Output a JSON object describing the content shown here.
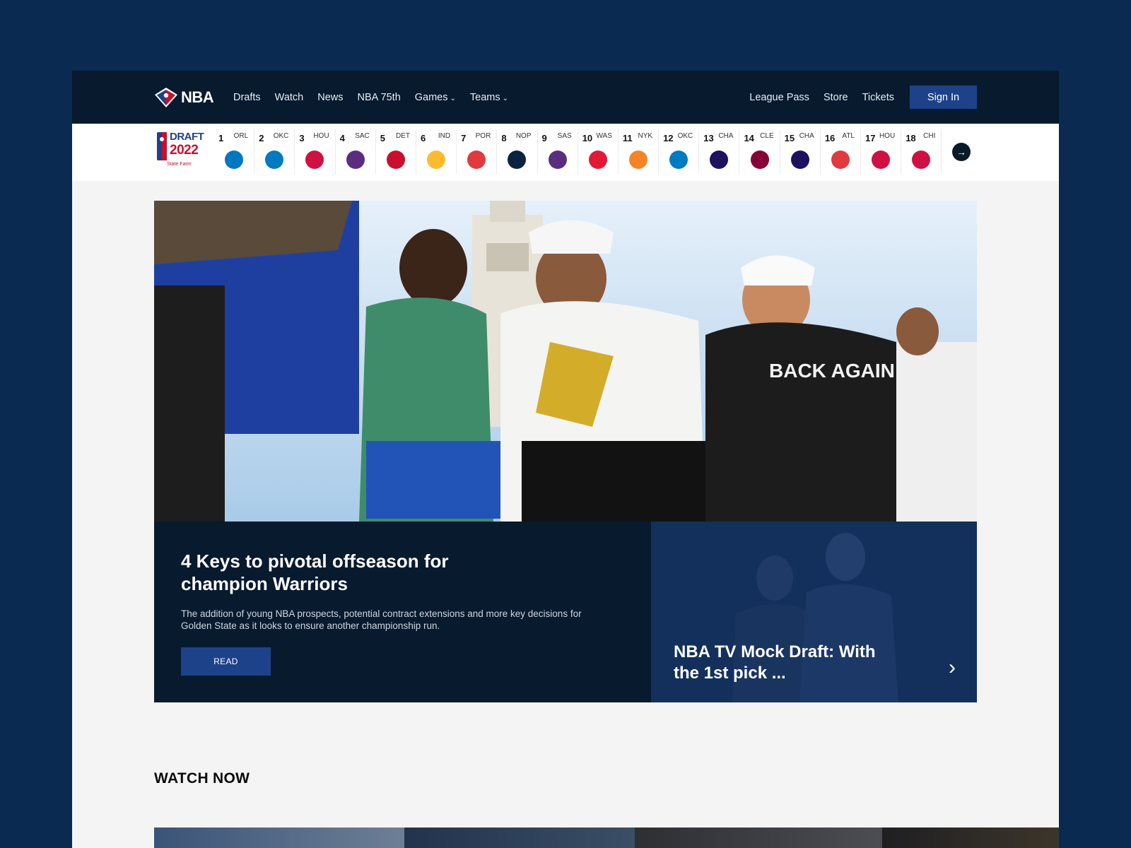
{
  "brand": {
    "name": "NBA"
  },
  "nav": {
    "left": [
      {
        "label": "Drafts",
        "dropdown": false
      },
      {
        "label": "Watch",
        "dropdown": false
      },
      {
        "label": "News",
        "dropdown": false
      },
      {
        "label": "NBA 75th",
        "dropdown": false
      },
      {
        "label": "Games",
        "dropdown": true
      },
      {
        "label": "Teams",
        "dropdown": true
      }
    ],
    "right": [
      {
        "label": "League Pass"
      },
      {
        "label": "Store"
      },
      {
        "label": "Tickets"
      }
    ],
    "signin_label": "Sign In"
  },
  "draft": {
    "logo_line1": "DRAFT",
    "logo_line2": "2022",
    "sponsor": "State Farm",
    "picks": [
      {
        "num": "1",
        "team": "ORL",
        "color": "#0077c0"
      },
      {
        "num": "2",
        "team": "OKC",
        "color": "#007ac1"
      },
      {
        "num": "3",
        "team": "HOU",
        "color": "#ce1141"
      },
      {
        "num": "4",
        "team": "SAC",
        "color": "#5a2d81"
      },
      {
        "num": "5",
        "team": "DET",
        "color": "#c8102e"
      },
      {
        "num": "6",
        "team": "IND",
        "color": "#fdbb30"
      },
      {
        "num": "7",
        "team": "POR",
        "color": "#e03a3e"
      },
      {
        "num": "8",
        "team": "NOP",
        "color": "#0c2340"
      },
      {
        "num": "9",
        "team": "SAS",
        "color": "#5a2d81"
      },
      {
        "num": "10",
        "team": "WAS",
        "color": "#e31837"
      },
      {
        "num": "11",
        "team": "NYK",
        "color": "#f58426"
      },
      {
        "num": "12",
        "team": "OKC",
        "color": "#007ac1"
      },
      {
        "num": "13",
        "team": "CHA",
        "color": "#1d1160"
      },
      {
        "num": "14",
        "team": "CLE",
        "color": "#860038"
      },
      {
        "num": "15",
        "team": "CHA",
        "color": "#1d1160"
      },
      {
        "num": "16",
        "team": "ATL",
        "color": "#e03a3e"
      },
      {
        "num": "17",
        "team": "HOU",
        "color": "#ce1141"
      },
      {
        "num": "18",
        "team": "CHI",
        "color": "#ce1141"
      }
    ]
  },
  "feature": {
    "title": "4 Keys to pivotal offseason for champion Warriors",
    "description": "The addition of young NBA prospects, potential contract extensions and more key decisions for Golden State as it looks to ensure another championship run.",
    "read_label": "READ"
  },
  "promo": {
    "title": "NBA TV Mock Draft: With the 1st pick ..."
  },
  "watch": {
    "title": "WATCH NOW"
  },
  "colors": {
    "background": "#0b2a52",
    "nav": "#071a2e",
    "accent": "#1d428a",
    "promo": "#13305c"
  },
  "icons": {
    "next": "arrow-right-icon",
    "promo_chevron": "chevron-right-icon",
    "dropdown": "chevron-down-icon"
  }
}
